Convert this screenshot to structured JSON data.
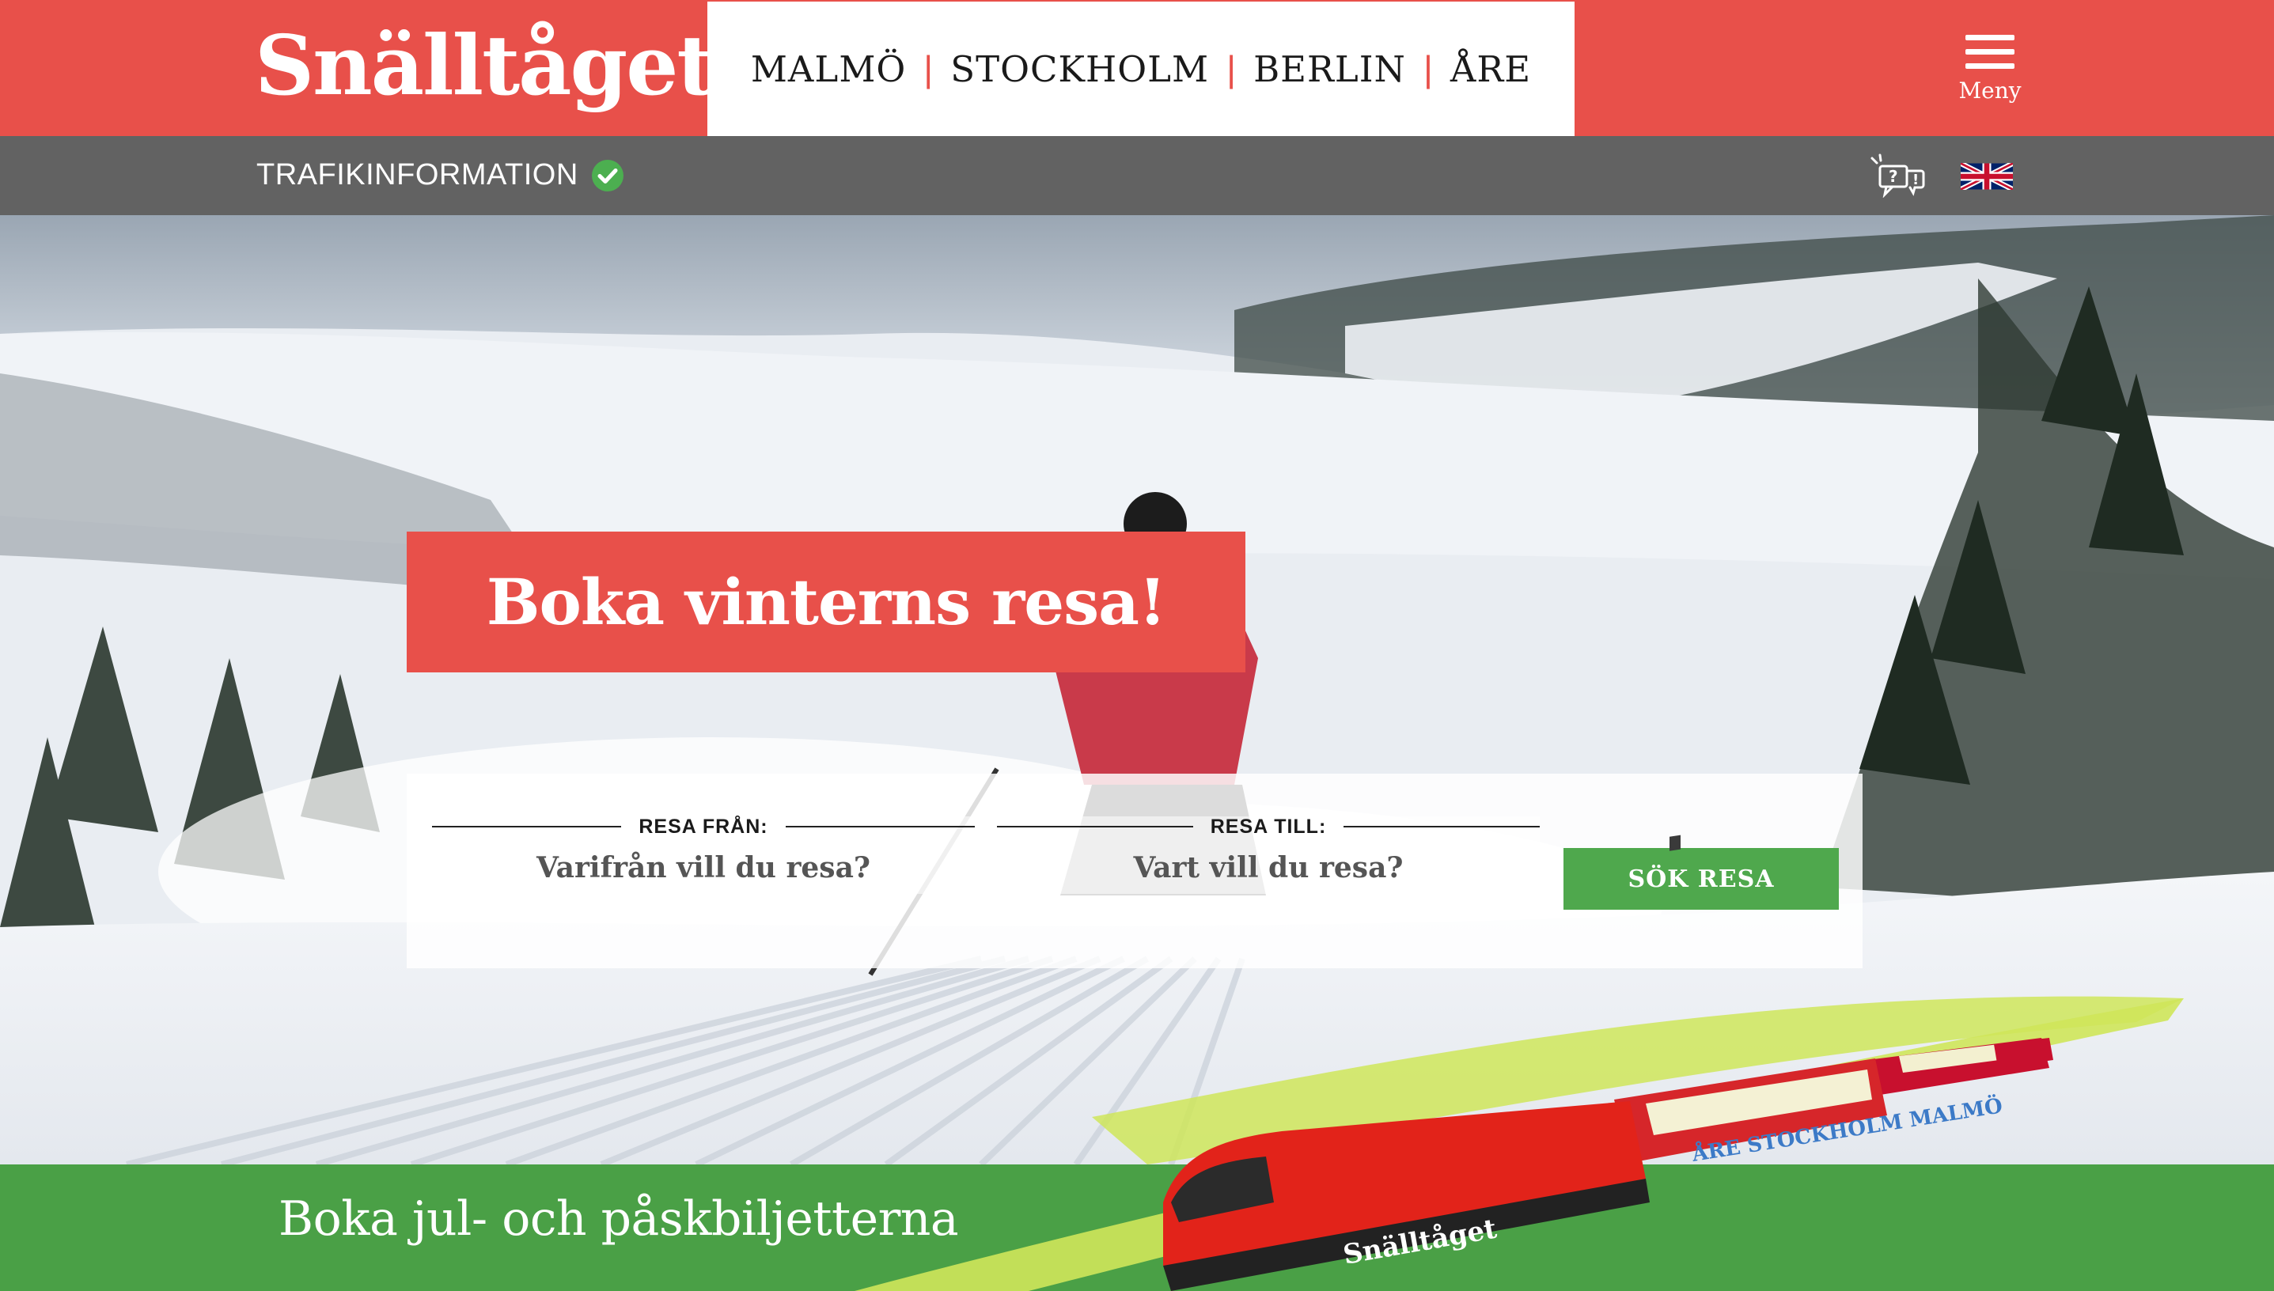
{
  "header": {
    "logo_text": "Snälltåget",
    "destinations": [
      {
        "label": "MALMÖ"
      },
      {
        "label": "STOCKHOLM"
      },
      {
        "label": "BERLIN"
      },
      {
        "label": "ÅRE"
      }
    ],
    "separator": "|",
    "menu_label": "Meny",
    "brand_color": "#e8504a"
  },
  "infobar": {
    "traffic_label": "TRAFIKINFORMATION",
    "traffic_status_icon": "check-circle-icon",
    "traffic_status_color": "#4caf50",
    "help_icon": "help-chat-icon",
    "language_icon": "uk-flag-icon"
  },
  "hero": {
    "title": "Boka vinterns resa!",
    "search": {
      "from_label": "RESA FRÅN:",
      "from_placeholder": "Varifrån vill du resa?",
      "to_label": "RESA TILL:",
      "to_placeholder": "Vart vill du resa?",
      "submit_label": "SÖK RESA",
      "submit_color": "#4fa84d"
    }
  },
  "promo": {
    "text": "Boka jul- och påskbiljetterna",
    "band_color": "#4aa046",
    "train_logo": "Snälltåget",
    "train_car_text": "ÅRE STOCKHOLM MALMÖ"
  }
}
